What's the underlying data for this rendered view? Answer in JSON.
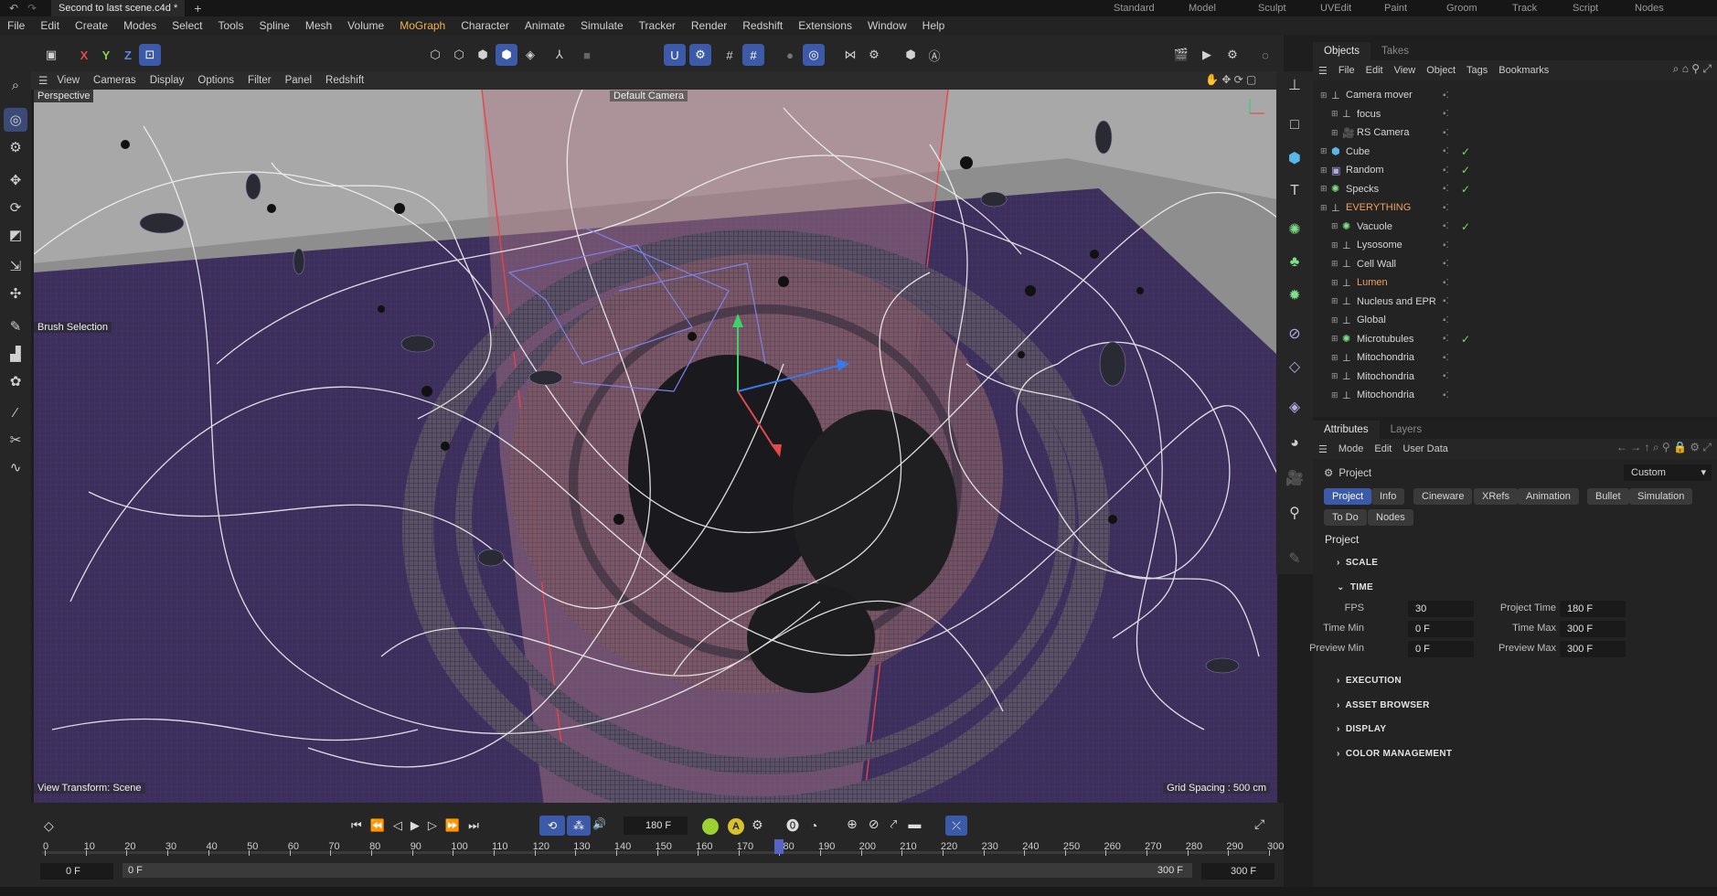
{
  "titlebar": {
    "tab_title": "Second to last scene.c4d *",
    "layouts": [
      "Standard",
      "Model",
      "Sculpt",
      "UVEdit",
      "Paint",
      "Groom",
      "Track",
      "Script",
      "Nodes"
    ]
  },
  "menu": [
    "File",
    "Edit",
    "Create",
    "Modes",
    "Select",
    "Tools",
    "Spline",
    "Mesh",
    "Volume",
    "MoGraph",
    "Character",
    "Animate",
    "Simulate",
    "Tracker",
    "Render",
    "Redshift",
    "Extensions",
    "Window",
    "Help"
  ],
  "toolbar": {
    "x": "X",
    "y": "Y",
    "z": "Z"
  },
  "viewport_menu": [
    "View",
    "Cameras",
    "Display",
    "Options",
    "Filter",
    "Panel",
    "Redshift"
  ],
  "viewport": {
    "label_perspective": "Perspective",
    "label_camera": "Default Camera",
    "label_brush": "Brush Selection",
    "label_transform": "View Transform: Scene",
    "label_grid": "Grid Spacing : 500 cm"
  },
  "objects_panel": {
    "tabs": [
      "Objects",
      "Takes"
    ],
    "menu": [
      "File",
      "Edit",
      "View",
      "Object",
      "Tags",
      "Bookmarks"
    ],
    "items": [
      {
        "name": "Camera mover",
        "indent": 0,
        "icon": "null-icon",
        "check": false
      },
      {
        "name": "focus",
        "indent": 1,
        "icon": "null-icon",
        "check": false
      },
      {
        "name": "RS Camera",
        "indent": 1,
        "icon": "camera-icon",
        "check": false
      },
      {
        "name": "Cube",
        "indent": 0,
        "icon": "cube-icon",
        "check": true
      },
      {
        "name": "Random",
        "indent": 0,
        "icon": "effector-icon",
        "check": true
      },
      {
        "name": "Specks",
        "indent": 0,
        "icon": "cloner-icon",
        "check": true
      },
      {
        "name": "EVERYTHING",
        "indent": 0,
        "icon": "null-icon",
        "check": false
      },
      {
        "name": "Vacuole",
        "indent": 1,
        "icon": "cloner-icon",
        "check": true
      },
      {
        "name": "Lysosome",
        "indent": 1,
        "icon": "null-icon",
        "check": false
      },
      {
        "name": "Cell Wall",
        "indent": 1,
        "icon": "null-icon",
        "check": false
      },
      {
        "name": "Lumen",
        "indent": 1,
        "icon": "null-icon",
        "check": false
      },
      {
        "name": "Nucleus and EPR",
        "indent": 1,
        "icon": "null-icon",
        "check": false
      },
      {
        "name": "Global",
        "indent": 1,
        "icon": "null-icon",
        "check": false
      },
      {
        "name": "Microtubules",
        "indent": 1,
        "icon": "cloner-icon",
        "check": true
      },
      {
        "name": "Mitochondria",
        "indent": 1,
        "icon": "null-icon",
        "check": false
      },
      {
        "name": "Mitochondria",
        "indent": 1,
        "icon": "null-icon",
        "check": false
      },
      {
        "name": "Mitochondria",
        "indent": 1,
        "icon": "null-icon",
        "check": false
      }
    ]
  },
  "attributes": {
    "tabs": [
      "Attributes",
      "Layers"
    ],
    "menu": [
      "Mode",
      "Edit",
      "User Data"
    ],
    "object_label": "Project",
    "preset": "Custom",
    "chips": [
      "Project",
      "Info",
      "Cineware",
      "XRefs",
      "Animation",
      "Bullet",
      "Simulation",
      "To Do",
      "Nodes"
    ],
    "section_title": "Project",
    "sections": {
      "scale": "SCALE",
      "time": "TIME",
      "execution": "EXECUTION",
      "asset_browser": "ASSET BROWSER",
      "display": "DISPLAY",
      "color_management": "COLOR MANAGEMENT"
    },
    "fields": {
      "fps_label": "FPS",
      "fps": "30",
      "project_time_label": "Project Time",
      "project_time": "180 F",
      "time_min_label": "Time Min",
      "time_min": "0 F",
      "time_max_label": "Time Max",
      "time_max": "300 F",
      "preview_min_label": "Preview Min",
      "preview_min": "0 F",
      "preview_max_label": "Preview Max",
      "preview_max": "300 F"
    }
  },
  "timeline": {
    "current_frame": "180 F",
    "ticks": [
      "0",
      "10",
      "20",
      "30",
      "40",
      "50",
      "60",
      "70",
      "80",
      "90",
      "100",
      "110",
      "120",
      "130",
      "140",
      "150",
      "160",
      "170",
      "180",
      "190",
      "200",
      "210",
      "220",
      "230",
      "240",
      "250",
      "260",
      "270",
      "280",
      "290",
      "300"
    ],
    "start": "0 F",
    "start2": "0 F",
    "end": "300 F",
    "end2": "300 F",
    "playhead_fraction": 0.6
  }
}
